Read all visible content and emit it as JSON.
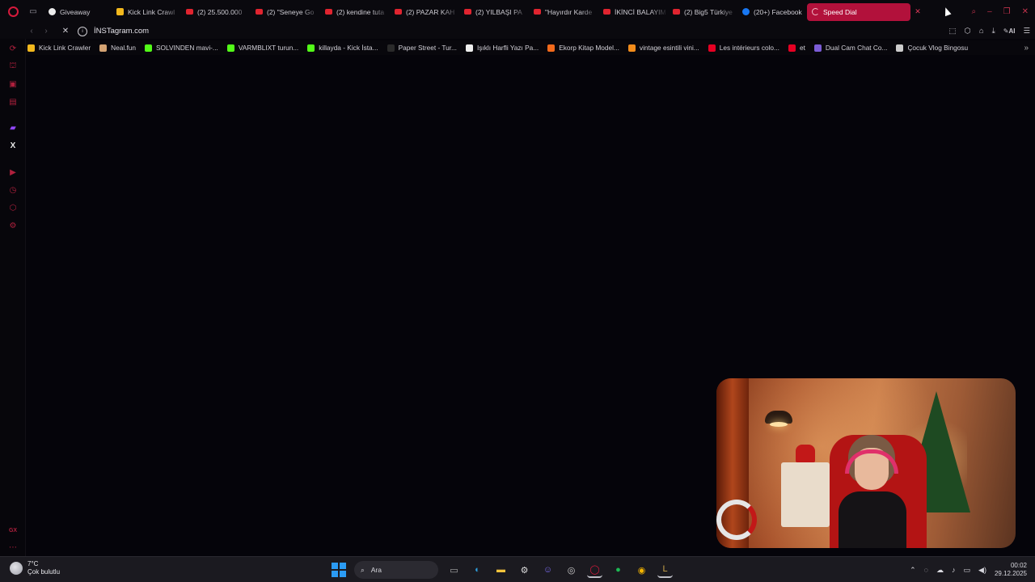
{
  "tabs": [
    {
      "label": "Giveaway",
      "favicon": "gear-favicon"
    },
    {
      "label": "Kick Link Crawl",
      "favicon": "kick-favicon"
    },
    {
      "label": "(2) 25.500.000",
      "favicon": "youtube-favicon"
    },
    {
      "label": "(2) \"Seneye Go",
      "favicon": "youtube-favicon"
    },
    {
      "label": "(2) kendine tuta",
      "favicon": "youtube-favicon"
    },
    {
      "label": "(2) PAZAR KAH",
      "favicon": "youtube-favicon"
    },
    {
      "label": "(2) YILBAŞI PA",
      "favicon": "youtube-favicon"
    },
    {
      "label": "\"Hayırdır Karde",
      "favicon": "youtube-favicon"
    },
    {
      "label": "İKİNCİ BALAYIM",
      "favicon": "youtube-favicon"
    },
    {
      "label": "(2) Big5 Türkiye",
      "favicon": "youtube-favicon"
    },
    {
      "label": "(20+) Facebook",
      "favicon": "facebook-favicon"
    },
    {
      "label": "Speed Dial",
      "favicon": "loading-spinner",
      "active": true
    }
  ],
  "address": {
    "url": "İNSTagram.com"
  },
  "bookmarks": [
    {
      "label": "Kick Link Crawler",
      "color": "#f2b81d"
    },
    {
      "label": "Neal.fun",
      "color": "#d4a373"
    },
    {
      "label": "SOLVINDEN mavi-...",
      "color": "#53fc18"
    },
    {
      "label": "VARMBLIXT turun...",
      "color": "#53fc18"
    },
    {
      "label": "killayda - Kick İsta...",
      "color": "#53fc18"
    },
    {
      "label": "Paper Street - Tur...",
      "color": "#2a2a2a"
    },
    {
      "label": "Işıklı Harfli Yazı Pa...",
      "color": "#eeeeee"
    },
    {
      "label": "Ekorp Kitap Model...",
      "color": "#f26a1b"
    },
    {
      "label": "vintage esintili vini...",
      "color": "#f28c1b"
    },
    {
      "label": "Les intérieurs colo...",
      "color": "#e60023"
    },
    {
      "label": "et",
      "color": "#e60023"
    },
    {
      "label": "Dual Cam Chat Co...",
      "color": "#7b5cd6"
    },
    {
      "label": "Çocuk Vlog Bingosu",
      "color": "#cccccc"
    }
  ],
  "taskbar": {
    "weather_temp": "7°C",
    "weather_desc": "Çok bulutlu",
    "search_label": "Ara",
    "time": "00:02",
    "date": "29.12.2025"
  },
  "colors": {
    "accent": "#b2113b",
    "sidebar_icon": "#b0203d",
    "background": "#05040a"
  }
}
